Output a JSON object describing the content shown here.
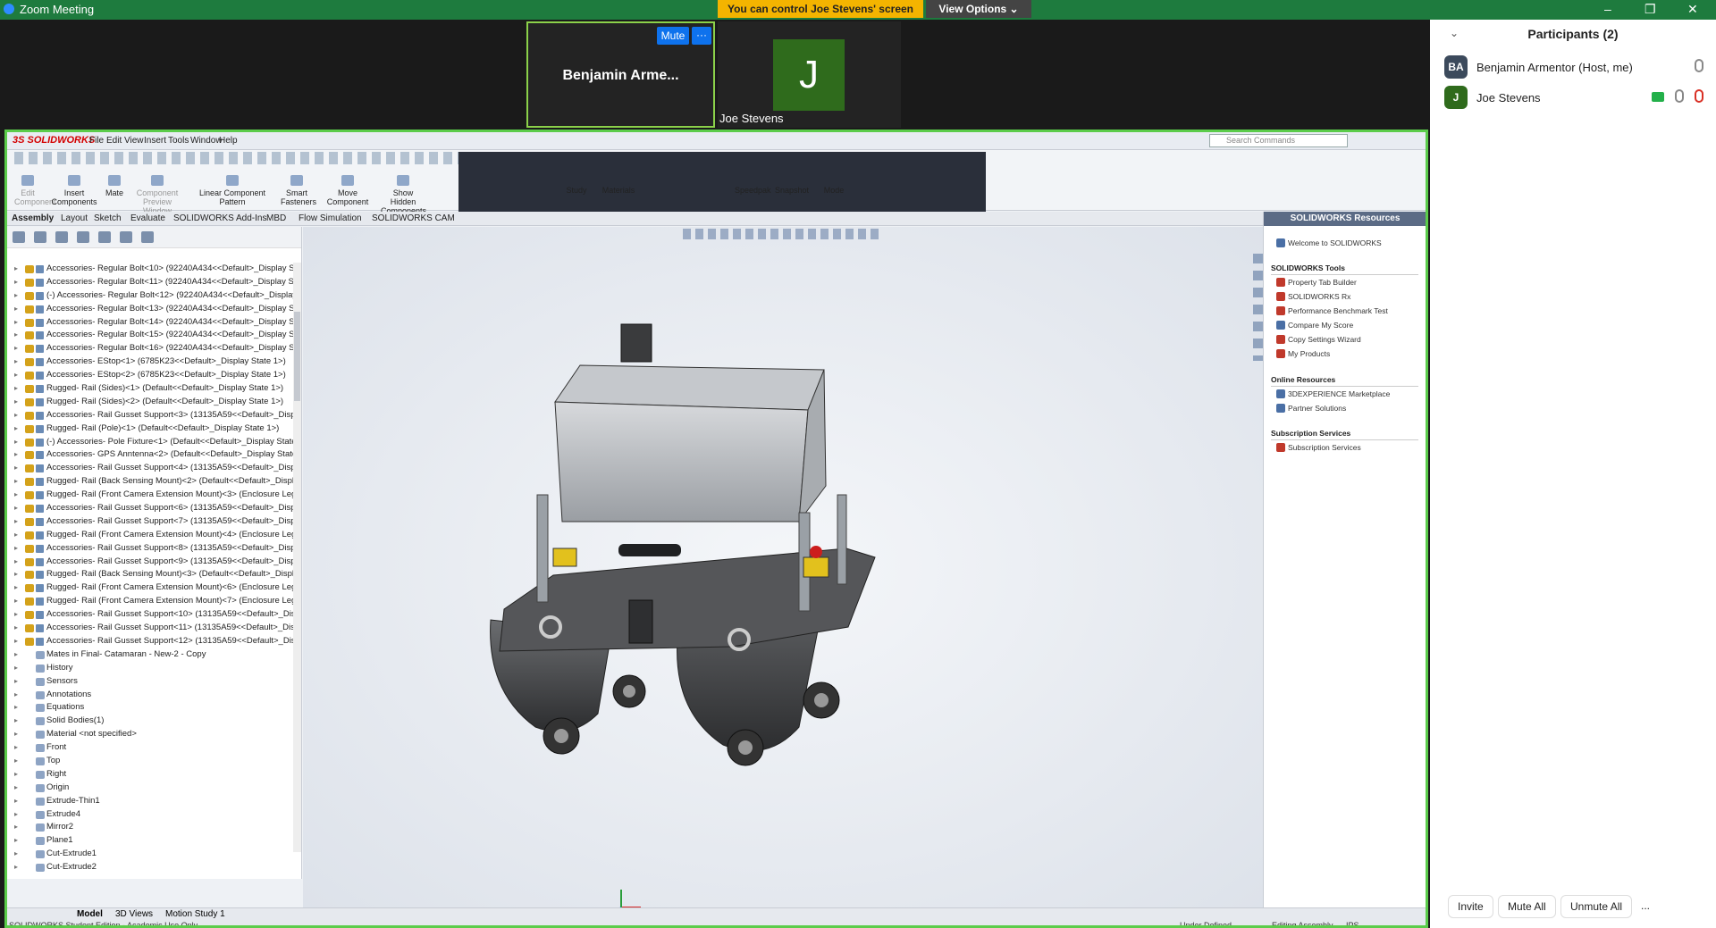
{
  "window": {
    "title": "Zoom Meeting",
    "min": "–",
    "max": "❐",
    "close": "✕"
  },
  "banner": {
    "control_text": "You can control Joe Stevens' screen",
    "view_options": "View Options ⌄"
  },
  "video": {
    "active_name": "Benjamin Arme...",
    "mute_label": "Mute",
    "more_label": "···",
    "tile2_initial": "J",
    "tile2_name": "Joe Stevens"
  },
  "solidworks": {
    "logo": "3S SOLIDWORKS",
    "menus": [
      "File",
      "Edit",
      "View",
      "Insert",
      "Tools",
      "Window",
      "Help"
    ],
    "search_placeholder": "Search Commands",
    "toolbar": [
      {
        "label": "Edit Component",
        "disabled": true
      },
      {
        "label": "Insert Components",
        "disabled": false
      },
      {
        "label": "Mate",
        "disabled": false
      },
      {
        "label": "Component Preview Window",
        "disabled": true
      },
      {
        "label": "Linear Component Pattern",
        "disabled": false
      },
      {
        "label": "Smart Fasteners",
        "disabled": false
      },
      {
        "label": "Move Component",
        "disabled": false
      },
      {
        "label": "Show Hidden Components",
        "disabled": false
      },
      {
        "label": "Study",
        "disabled": false
      },
      {
        "label": "Materials",
        "disabled": false
      },
      {
        "label": "Speedpak",
        "disabled": false
      },
      {
        "label": "Snapshot",
        "disabled": false
      },
      {
        "label": "Mode",
        "disabled": false
      }
    ],
    "tabs": [
      "Assembly",
      "Layout",
      "Sketch",
      "Evaluate",
      "SOLIDWORKS Add-Ins",
      "MBD",
      "Flow Simulation",
      "SOLIDWORKS CAM"
    ],
    "tree_items": [
      "Accessories- Regular Bolt<10> (92240A434<<Default>_Display St",
      "Accessories- Regular Bolt<11> (92240A434<<Default>_Display St",
      "(-) Accessories- Regular Bolt<12> (92240A434<<Default>_Display",
      "Accessories- Regular Bolt<13> (92240A434<<Default>_Display St",
      "Accessories- Regular Bolt<14> (92240A434<<Default>_Display St",
      "Accessories- Regular Bolt<15> (92240A434<<Default>_Display St",
      "Accessories- Regular Bolt<16> (92240A434<<Default>_Display St",
      "Accessories- EStop<1> (6785K23<<Default>_Display State 1>)",
      "Accessories- EStop<2> (6785K23<<Default>_Display State 1>)",
      "Rugged- Rail (Sides)<1> (Default<<Default>_Display State 1>)",
      "Rugged- Rail (Sides)<2> (Default<<Default>_Display State 1>)",
      "Accessories- Rail Gusset Support<3> (13135A59<<Default>_Displ",
      "Rugged- Rail (Pole)<1> (Default<<Default>_Display State 1>)",
      "(-) Accessories- Pole Fixture<1> (Default<<Default>_Display State",
      "Accessories- GPS Anntenna<2> (Default<<Default>_Display State",
      "Accessories- Rail Gusset Support<4> (13135A59<<Default>_Displ",
      "Rugged- Rail (Back Sensing Mount)<2> (Default<<Default>_Displ",
      "Rugged- Rail (Front Camera Extension Mount)<3> (Enclosure Leg<",
      "Accessories- Rail Gusset Support<6> (13135A59<<Default>_Displ",
      "Accessories- Rail Gusset Support<7> (13135A59<<Default>_Displ",
      "Rugged- Rail (Front Camera Extension Mount)<4> (Enclosure Leg<",
      "Accessories- Rail Gusset Support<8> (13135A59<<Default>_Displ",
      "Accessories- Rail Gusset Support<9> (13135A59<<Default>_Displ",
      "Rugged- Rail (Back Sensing Mount)<3> (Default<<Default>_Displ",
      "Rugged- Rail (Front Camera Extension Mount)<6> (Enclosure Leg<",
      "Rugged- Rail (Front Camera Extension Mount)<7> (Enclosure Leg<",
      "Accessories- Rail Gusset Support<10> (13135A59<<Default>_Disp",
      "Accessories- Rail Gusset Support<11> (13135A59<<Default>_Disp",
      "Accessories- Rail Gusset Support<12> (13135A59<<Default>_Disp"
    ],
    "feature_items": [
      "Mates in Final- Catamaran - New-2 - Copy",
      "History",
      "Sensors",
      "Annotations",
      "Equations",
      "Solid Bodies(1)",
      "Material <not specified>",
      "Front",
      "Top",
      "Right",
      "Origin",
      "Extrude-Thin1",
      "Extrude4",
      "Mirror2",
      "Plane1",
      "Cut-Extrude1",
      "Cut-Extrude2"
    ],
    "bottom_tabs": [
      "Model",
      "3D Views",
      "Motion Study 1"
    ],
    "status_left": "SOLIDWORKS Student Edition - Academic Use Only",
    "status_right": [
      "Under Defined",
      "Editing Assembly",
      "IPS"
    ]
  },
  "resources": {
    "title": "SOLIDWORKS Resources",
    "welcome": "Welcome to SOLIDWORKS",
    "tools_title": "SOLIDWORKS Tools",
    "tools": [
      "Property Tab Builder",
      "SOLIDWORKS Rx",
      "Performance Benchmark Test",
      "Compare My Score",
      "Copy Settings Wizard",
      "My Products"
    ],
    "online_title": "Online Resources",
    "online": [
      "3DEXPERIENCE Marketplace",
      "Partner Solutions"
    ],
    "subs_title": "Subscription Services",
    "subs": [
      "Subscription Services"
    ]
  },
  "participants": {
    "title": "Participants (2)",
    "list": [
      {
        "initials": "BA",
        "name": "Benjamin Armentor (Host, me)",
        "color": "#3c4a5c"
      },
      {
        "initials": "J",
        "name": "Joe Stevens",
        "color": "#2f6b1c"
      }
    ],
    "buttons": [
      "Invite",
      "Mute All",
      "Unmute All",
      "..."
    ]
  }
}
